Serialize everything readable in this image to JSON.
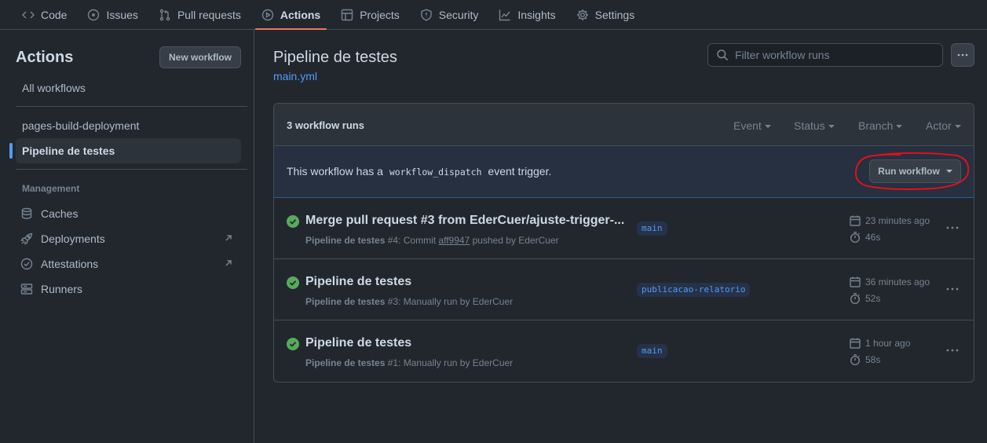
{
  "nav": [
    {
      "label": "Code",
      "icon": "code-icon",
      "active": false
    },
    {
      "label": "Issues",
      "icon": "issue-icon",
      "active": false
    },
    {
      "label": "Pull requests",
      "icon": "pull-request-icon",
      "active": false
    },
    {
      "label": "Actions",
      "icon": "play-icon",
      "active": true
    },
    {
      "label": "Projects",
      "icon": "table-icon",
      "active": false
    },
    {
      "label": "Security",
      "icon": "shield-icon",
      "active": false
    },
    {
      "label": "Insights",
      "icon": "graph-icon",
      "active": false
    },
    {
      "label": "Settings",
      "icon": "gear-icon",
      "active": false
    }
  ],
  "sidebar": {
    "title": "Actions",
    "new_workflow": "New workflow",
    "all_workflows": "All workflows",
    "workflows": [
      "pages-build-deployment",
      "Pipeline de testes"
    ],
    "selected_workflow": "Pipeline de testes",
    "management_heading": "Management",
    "management": [
      {
        "label": "Caches",
        "icon": "database-icon"
      },
      {
        "label": "Deployments",
        "icon": "rocket-icon"
      },
      {
        "label": "Attestations",
        "icon": "verified-icon"
      },
      {
        "label": "Runners",
        "icon": "server-icon"
      }
    ]
  },
  "main": {
    "title": "Pipeline de testes",
    "file": "main.yml",
    "filter_placeholder": "Filter workflow runs",
    "runs_count": "3 workflow runs",
    "filters": [
      "Event",
      "Status",
      "Branch",
      "Actor"
    ],
    "dispatch_before": "This workflow has a",
    "dispatch_code": "workflow_dispatch",
    "dispatch_after": "event trigger.",
    "run_workflow": "Run workflow",
    "runs": [
      {
        "title": "Merge pull request #3 from EderCuer/ajuste-trigger-...",
        "workflow": "Pipeline de testes",
        "number": "#4",
        "desc_pre": ": Commit ",
        "sha": "aff9947",
        "desc_post": " pushed by EderCuer",
        "branch": "main",
        "when": "23 minutes ago",
        "duration": "46s",
        "status": "success"
      },
      {
        "title": "Pipeline de testes",
        "workflow": "Pipeline de testes",
        "number": "#3",
        "desc_pre": ": Manually run by EderCuer",
        "sha": "",
        "desc_post": "",
        "branch": "publicacao-relatorio",
        "when": "36 minutes ago",
        "duration": "52s",
        "status": "success"
      },
      {
        "title": "Pipeline de testes",
        "workflow": "Pipeline de testes",
        "number": "#1",
        "desc_pre": ": Manually run by EderCuer",
        "sha": "",
        "desc_post": "",
        "branch": "main",
        "when": "1 hour ago",
        "duration": "58s",
        "status": "success"
      }
    ]
  },
  "colors": {
    "background": "#22272e",
    "accent_link": "#539bf5",
    "active_tab_underline": "#ec775c",
    "success": "#57ab5a",
    "annotation_ring": "#e0101a"
  }
}
